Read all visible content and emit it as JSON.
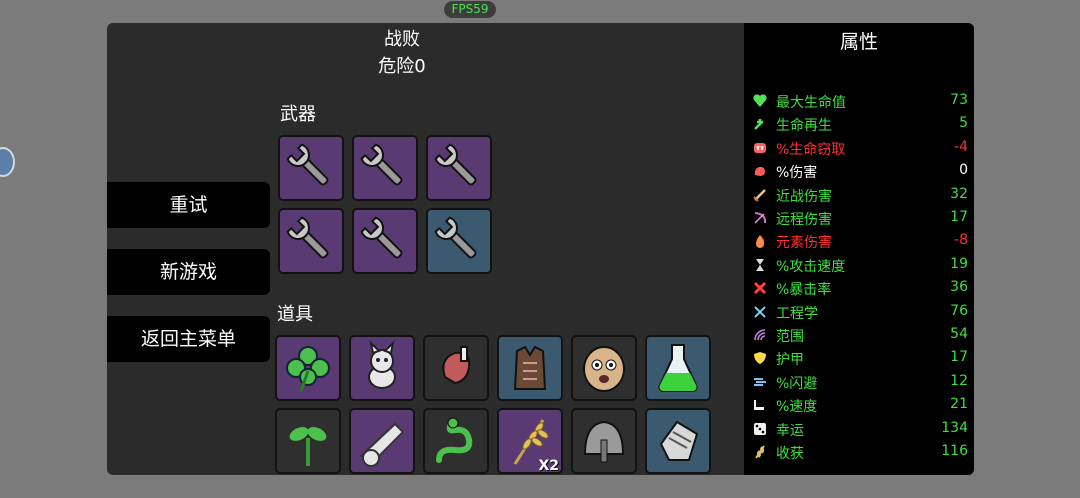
{
  "fps": "FPS59",
  "header": {
    "result": "战败",
    "danger": "危险0"
  },
  "weapons_label": "武器",
  "items_label": "道具",
  "buttons": {
    "retry": "重试",
    "new_game": "新游戏",
    "main_menu": "返回主菜单"
  },
  "weapons": [
    {
      "icon": "wrench-icon",
      "tier": "purple"
    },
    {
      "icon": "wrench-icon",
      "tier": "purple"
    },
    {
      "icon": "wrench-icon",
      "tier": "purple"
    },
    {
      "icon": "wrench-icon",
      "tier": "purple"
    },
    {
      "icon": "wrench-icon",
      "tier": "purple"
    },
    {
      "icon": "wrench-icon",
      "tier": "blue"
    }
  ],
  "items": [
    {
      "icon": "clover-icon",
      "tier": "purple"
    },
    {
      "icon": "cat-toy-icon",
      "tier": "purple"
    },
    {
      "icon": "meat-icon",
      "tier": "dark"
    },
    {
      "icon": "vest-icon",
      "tier": "blue"
    },
    {
      "icon": "potato-face-icon",
      "tier": "dark"
    },
    {
      "icon": "potion-icon",
      "tier": "blue"
    },
    {
      "icon": "sprout-icon",
      "tier": "dark"
    },
    {
      "icon": "cannon-icon",
      "tier": "purple"
    },
    {
      "icon": "snake-icon",
      "tier": "dark"
    },
    {
      "icon": "wheat-icon",
      "tier": "purple",
      "qty": "X2"
    },
    {
      "icon": "helmet-icon",
      "tier": "dark"
    },
    {
      "icon": "glove-icon",
      "tier": "blue"
    }
  ],
  "stats": {
    "title": "属性",
    "rows": [
      {
        "icon": "heart-icon",
        "label": "最大生命值",
        "value": "73",
        "color": "#3ee03e"
      },
      {
        "icon": "regen-icon",
        "label": "生命再生",
        "value": "5",
        "color": "#3ee03e"
      },
      {
        "icon": "fang-icon",
        "label": "%生命窃取",
        "value": "-4",
        "color": "#ff3030"
      },
      {
        "icon": "muscle-icon",
        "label": "%伤害",
        "value": "0",
        "color": "#ffffff"
      },
      {
        "icon": "sword-icon",
        "label": "近战伤害",
        "value": "32",
        "color": "#3ee03e"
      },
      {
        "icon": "bow-icon",
        "label": "远程伤害",
        "value": "17",
        "color": "#3ee03e"
      },
      {
        "icon": "flame-icon",
        "label": "元素伤害",
        "value": "-8",
        "color": "#ff3030"
      },
      {
        "icon": "hourglass-icon",
        "label": "%攻击速度",
        "value": "19",
        "color": "#3ee03e"
      },
      {
        "icon": "crit-icon",
        "label": "%暴击率",
        "value": "36",
        "color": "#3ee03e"
      },
      {
        "icon": "tools-icon",
        "label": "工程学",
        "value": "76",
        "color": "#3ee03e"
      },
      {
        "icon": "range-icon",
        "label": "范围",
        "value": "54",
        "color": "#3ee03e"
      },
      {
        "icon": "shield-icon",
        "label": "护甲",
        "value": "17",
        "color": "#3ee03e"
      },
      {
        "icon": "dodge-icon",
        "label": "%闪避",
        "value": "12",
        "color": "#3ee03e"
      },
      {
        "icon": "boot-icon",
        "label": "%速度",
        "value": "21",
        "color": "#3ee03e"
      },
      {
        "icon": "dice-icon",
        "label": "幸运",
        "value": "134",
        "color": "#3ee03e"
      },
      {
        "icon": "harvest-icon",
        "label": "收获",
        "value": "116",
        "color": "#3ee03e"
      }
    ]
  }
}
